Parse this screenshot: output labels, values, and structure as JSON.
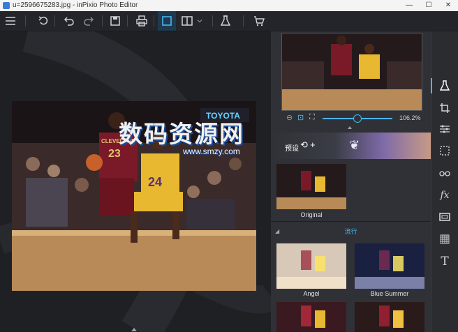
{
  "window": {
    "title": "u=2596675283.jpg - inPixio Photo Editor",
    "minimize": "—",
    "maximize": "☐",
    "close": "✕"
  },
  "watermark": {
    "text": "数码资源网",
    "url": "www.smzy.com"
  },
  "panel": {
    "zoom_value": "106.2%",
    "preset_label": "预设",
    "original_caption": "Original",
    "section_title": "流行",
    "presets": [
      {
        "caption": "Angel"
      },
      {
        "caption": "Blue Summer"
      }
    ]
  },
  "colors": {
    "accent": "#4fb4e8",
    "background": "#2b2d31"
  },
  "photo_text": {
    "cavs_team": "CLEVELAND",
    "cavs_number": "23",
    "lakers_number": "24",
    "banner": "TOYOTA"
  }
}
